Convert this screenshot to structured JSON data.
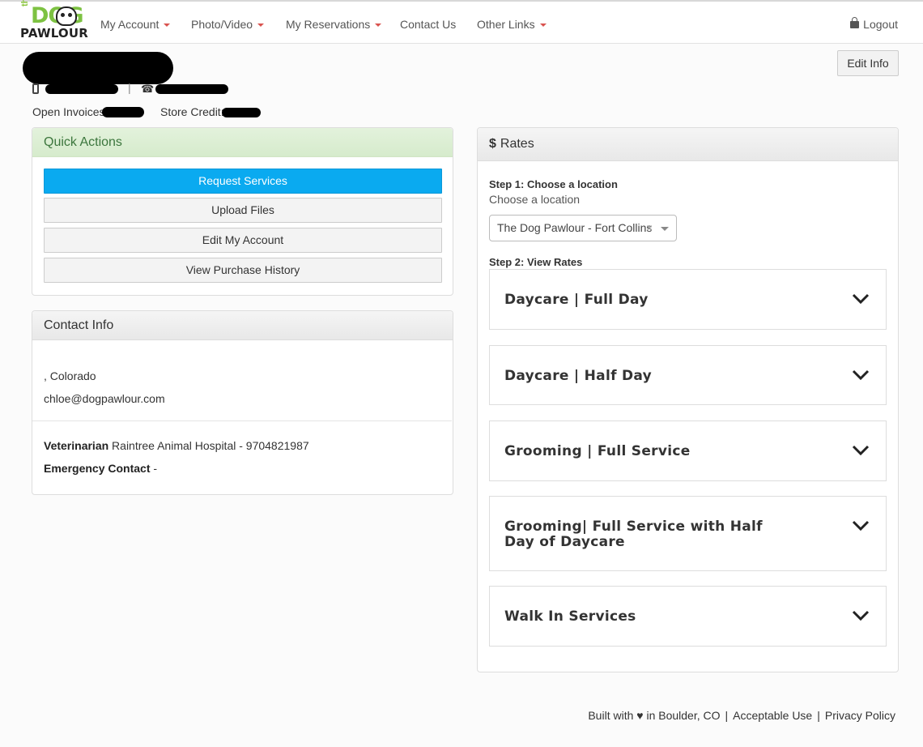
{
  "brand": {
    "the": "the",
    "dog": "DOG",
    "pawlour": "PAWLOUR"
  },
  "nav": {
    "items": [
      {
        "label": "My Account",
        "has_caret": true
      },
      {
        "label": "Photo/Video",
        "has_caret": true
      },
      {
        "label": "My Reservations",
        "has_caret": true
      },
      {
        "label": "Contact Us",
        "has_caret": false
      },
      {
        "label": "Other Links",
        "has_caret": true
      }
    ],
    "logout": "Logout",
    "caret_color": "#d9534f"
  },
  "profile": {
    "edit_button": "Edit Info",
    "separator": "|",
    "open_invoices_label": "Open Invoices:",
    "store_credit_label": "Store Credit:"
  },
  "quick_actions": {
    "title": "Quick Actions",
    "buttons": [
      "Request Services",
      "Upload Files",
      "Edit My Account",
      "View Purchase History"
    ],
    "primary_color": "#0aaaf0"
  },
  "contact_info": {
    "title": "Contact Info",
    "location": ", Colorado",
    "email": "chloe@dogpawlour.com",
    "vet_label": "Veterinarian",
    "vet_value": "Raintree Animal Hospital - 9704821987",
    "emergency_label": "Emergency Contact",
    "emergency_value": "-"
  },
  "rates": {
    "title": "Rates",
    "step1_label": "Step 1: Choose a location",
    "step1_sub": "Choose a location",
    "location_value": "The Dog Pawlour - Fort Collins",
    "clear_symbol": "×",
    "step2_label": "Step 2: View Rates",
    "items": [
      "Daycare | Full Day",
      "Daycare | Half Day",
      "Grooming | Full Service",
      "Grooming| Full Service with Half Day of Daycare",
      "Walk In Services"
    ]
  },
  "footer": {
    "built_with": "Built with ♥ in Boulder, CO",
    "separator": "|",
    "acceptable_use": "Acceptable Use",
    "privacy_policy": "Privacy Policy"
  }
}
